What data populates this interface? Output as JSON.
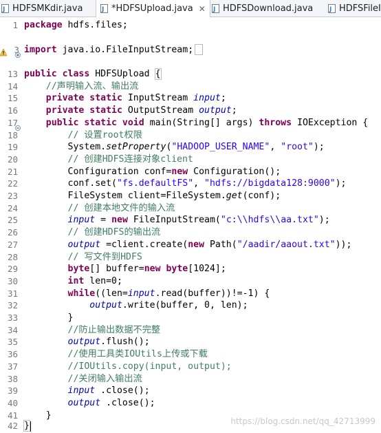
{
  "tabs": [
    {
      "label": "HDFSMKdir.java",
      "active": false,
      "closable": false
    },
    {
      "label": "*HDFSUpload.java",
      "active": true,
      "closable": true
    },
    {
      "label": "HDFSDownload.java",
      "active": false,
      "closable": false
    },
    {
      "label": "HDFSFileI",
      "active": false,
      "closable": false
    }
  ],
  "line_numbers": [
    "1",
    "3",
    "13",
    "14",
    "15",
    "16",
    "17",
    "18",
    "19",
    "20",
    "21",
    "22",
    "23",
    "24",
    "25",
    "26",
    "27",
    "28",
    "29",
    "30",
    "31",
    "32",
    "33",
    "34",
    "35",
    "36",
    "37",
    "38",
    "39",
    "40",
    "41",
    "42"
  ],
  "code": {
    "l1_kw": "package",
    "l1_rest": " hdfs.files;",
    "l3_kw": "import",
    "l3_rest": " java.io.FileInputStream;",
    "l13_kw": "public class",
    "l13_rest": " HDFSUpload ",
    "l13_brace": "{",
    "l14": "    //声明输入流、输出流",
    "l15_ind": "    ",
    "l15_kw": "private static",
    "l15_type": " InputStream ",
    "l15_fld": "input",
    "l15_end": ";",
    "l16_ind": "    ",
    "l16_kw": "private static",
    "l16_type": " OutputStream ",
    "l16_fld": "output",
    "l16_end": ";",
    "l17_ind": "    ",
    "l17_kw": "public static void",
    "l17_mid": " main(String[] args) ",
    "l17_kw2": "throws",
    "l17_end": " IOException {",
    "l18": "        // 设置root权限",
    "l19_a": "        System.",
    "l19_m": "setProperty",
    "l19_b": "(",
    "l19_s1": "\"HADOOP_USER_NAME\"",
    "l19_c": ", ",
    "l19_s2": "\"root\"",
    "l19_d": ");",
    "l20": "        // 创建HDFS连接对象client",
    "l21_a": "        Configuration conf=",
    "l21_kw": "new",
    "l21_b": " Configuration();",
    "l22_a": "        conf.set(",
    "l22_s1": "\"fs.defaultFS\"",
    "l22_c": ", ",
    "l22_s2": "\"hdfs://bigdata128:9000\"",
    "l22_d": ");",
    "l23_a": "        FileSystem client=FileSystem.",
    "l23_m": "get",
    "l23_b": "(conf);",
    "l24": "        // 创建本地文件的输入流",
    "l25_ind": "        ",
    "l25_fld": "input",
    "l25_a": " = ",
    "l25_kw": "new",
    "l25_b": " FileInputStream(",
    "l25_s": "\"c:\\\\hdfs\\\\aa.txt\"",
    "l25_c": ");",
    "l26": "        // 创建HDFS的输出流",
    "l27_ind": "        ",
    "l27_fld": "output",
    "l27_a": " =client.create(",
    "l27_kw": "new",
    "l27_b": " Path(",
    "l27_s": "\"/aadir/aaout.txt\"",
    "l27_c": "));",
    "l28": "        // 写文件到HDFS",
    "l29_kw": "        byte",
    "l29_a": "[] buffer=",
    "l29_kw2": "new",
    "l29_kw3": " byte",
    "l29_b": "[1024];",
    "l30_kw": "        int",
    "l30_a": " len=0;",
    "l31_kw": "        while",
    "l31_a": "((len=",
    "l31_fld": "input",
    "l31_b": ".read(buffer))!=-1) {",
    "l32_ind": "            ",
    "l32_fld": "output",
    "l32_a": ".write(buffer, 0, len);",
    "l33": "        }",
    "l34": "        //防止输出数据不完整",
    "l35_ind": "        ",
    "l35_fld": "output",
    "l35_a": ".flush();",
    "l36": "        //使用工具类IOUtils上传或下载",
    "l37": "        //IOUtils.copy(input, output);",
    "l38": "        //关闭输入输出流",
    "l39_ind": "        ",
    "l39_fld": "input",
    "l39_a": " .close();",
    "l40_ind": "        ",
    "l40_fld": "output",
    "l40_a": " .close();",
    "l41": "    }",
    "l42": "}"
  },
  "watermark": "https://blog.csdn.net/qq_42713999",
  "colors": {
    "keyword": "#7f0055",
    "comment": "#3f7f5f",
    "string": "#2a00ff",
    "field": "#0000c0"
  },
  "icons": [
    "java-file-icon",
    "close-icon",
    "warning-icon",
    "fold-icon"
  ]
}
